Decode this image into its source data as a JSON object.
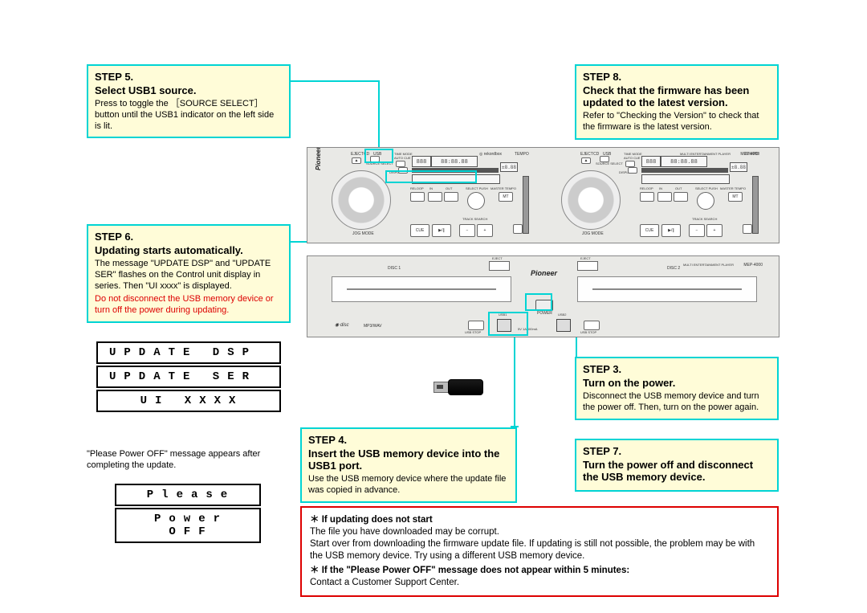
{
  "step5": {
    "num": "STEP 5.",
    "heading": "Select USB1 source.",
    "body": "Press to toggle the ［SOURCE SELECT］ button until the USB1 indicator on the left side is lit."
  },
  "step6": {
    "num": "STEP 6.",
    "heading": "Updating starts automatically.",
    "body1": "The message \"UPDATE DSP\" and \"UPDATE SER\" flashes on the Control unit display in series. Then \"UI xxxx\" is displayed.",
    "body2": "Do not disconnect the USB memory device or turn off the power during updating."
  },
  "displays": {
    "d1": "UPDATE DSP",
    "d2": "UPDATE SER",
    "d3": "UI XXXX",
    "d4": "Please",
    "d5": "Power OFF"
  },
  "notes_step6": {
    "n1": "\"Please Power OFF\" message appears after completing the update."
  },
  "step8": {
    "num": "STEP 8.",
    "heading": "Check that the firmware has been updated to the latest version.",
    "body": "Refer to \"Checking the Version\" to check that the firmware is the latest version."
  },
  "step3": {
    "num": "STEP 3.",
    "heading": "Turn on the power.",
    "body": "Disconnect the USB memory device and turn the power off. Then, turn on the power again."
  },
  "step7": {
    "num": "STEP 7.",
    "heading": "Turn the power off and disconnect the USB memory device."
  },
  "step4": {
    "num": "STEP 4.",
    "heading": "Insert the USB memory device into the USB1 port.",
    "body": "Use the USB memory device where the update file was copied in advance."
  },
  "warn": {
    "h1": "＊ If updating does not start",
    "b1": "The file you have downloaded may be corrupt.",
    "b2": "Start over from downloading the firmware update file. If updating is still not possible, the problem may be with the USB memory device. Try using a different USB memory device.",
    "h2": "＊ If the \"Please Power OFF\" message does not appear within 5 minutes:",
    "b3": "Contact a Customer Support Center."
  },
  "device": {
    "brand": "Pioneer",
    "model_top": "MEP-4000",
    "model_label": "MULTI ENTERTAINMENT PLAYER",
    "disc1": "DISC 1",
    "disc2": "DISC 2",
    "power": "POWER",
    "mp3": "MP3/WAV",
    "usbstop1": "USB STOP",
    "usbstop2": "USB STOP",
    "usbrating": "5V 1A 500mA",
    "usb1": "USB1",
    "usb2": "USB2",
    "cue": "CUE",
    "play": "▶/∥",
    "reloop": "RELOOP",
    "in": "IN",
    "out": "OUT",
    "mt": "MT",
    "jog": "JOG MODE",
    "track_search": "TRACK SEARCH",
    "select_push": "SELECT PUSH",
    "master_tempo": "MASTER TEMPO",
    "tempo": "TEMPO",
    "eject": "EJECT",
    "src": "SOURCE SELECT",
    "cd": "CD",
    "usb": "USB",
    "timemode": "TIME MODE",
    "autocue": "AUTO CUE",
    "rekord": "rekordbox",
    "display": "DISPLAY",
    "seg_time": "88:88.88",
    "seg_n": "888"
  }
}
